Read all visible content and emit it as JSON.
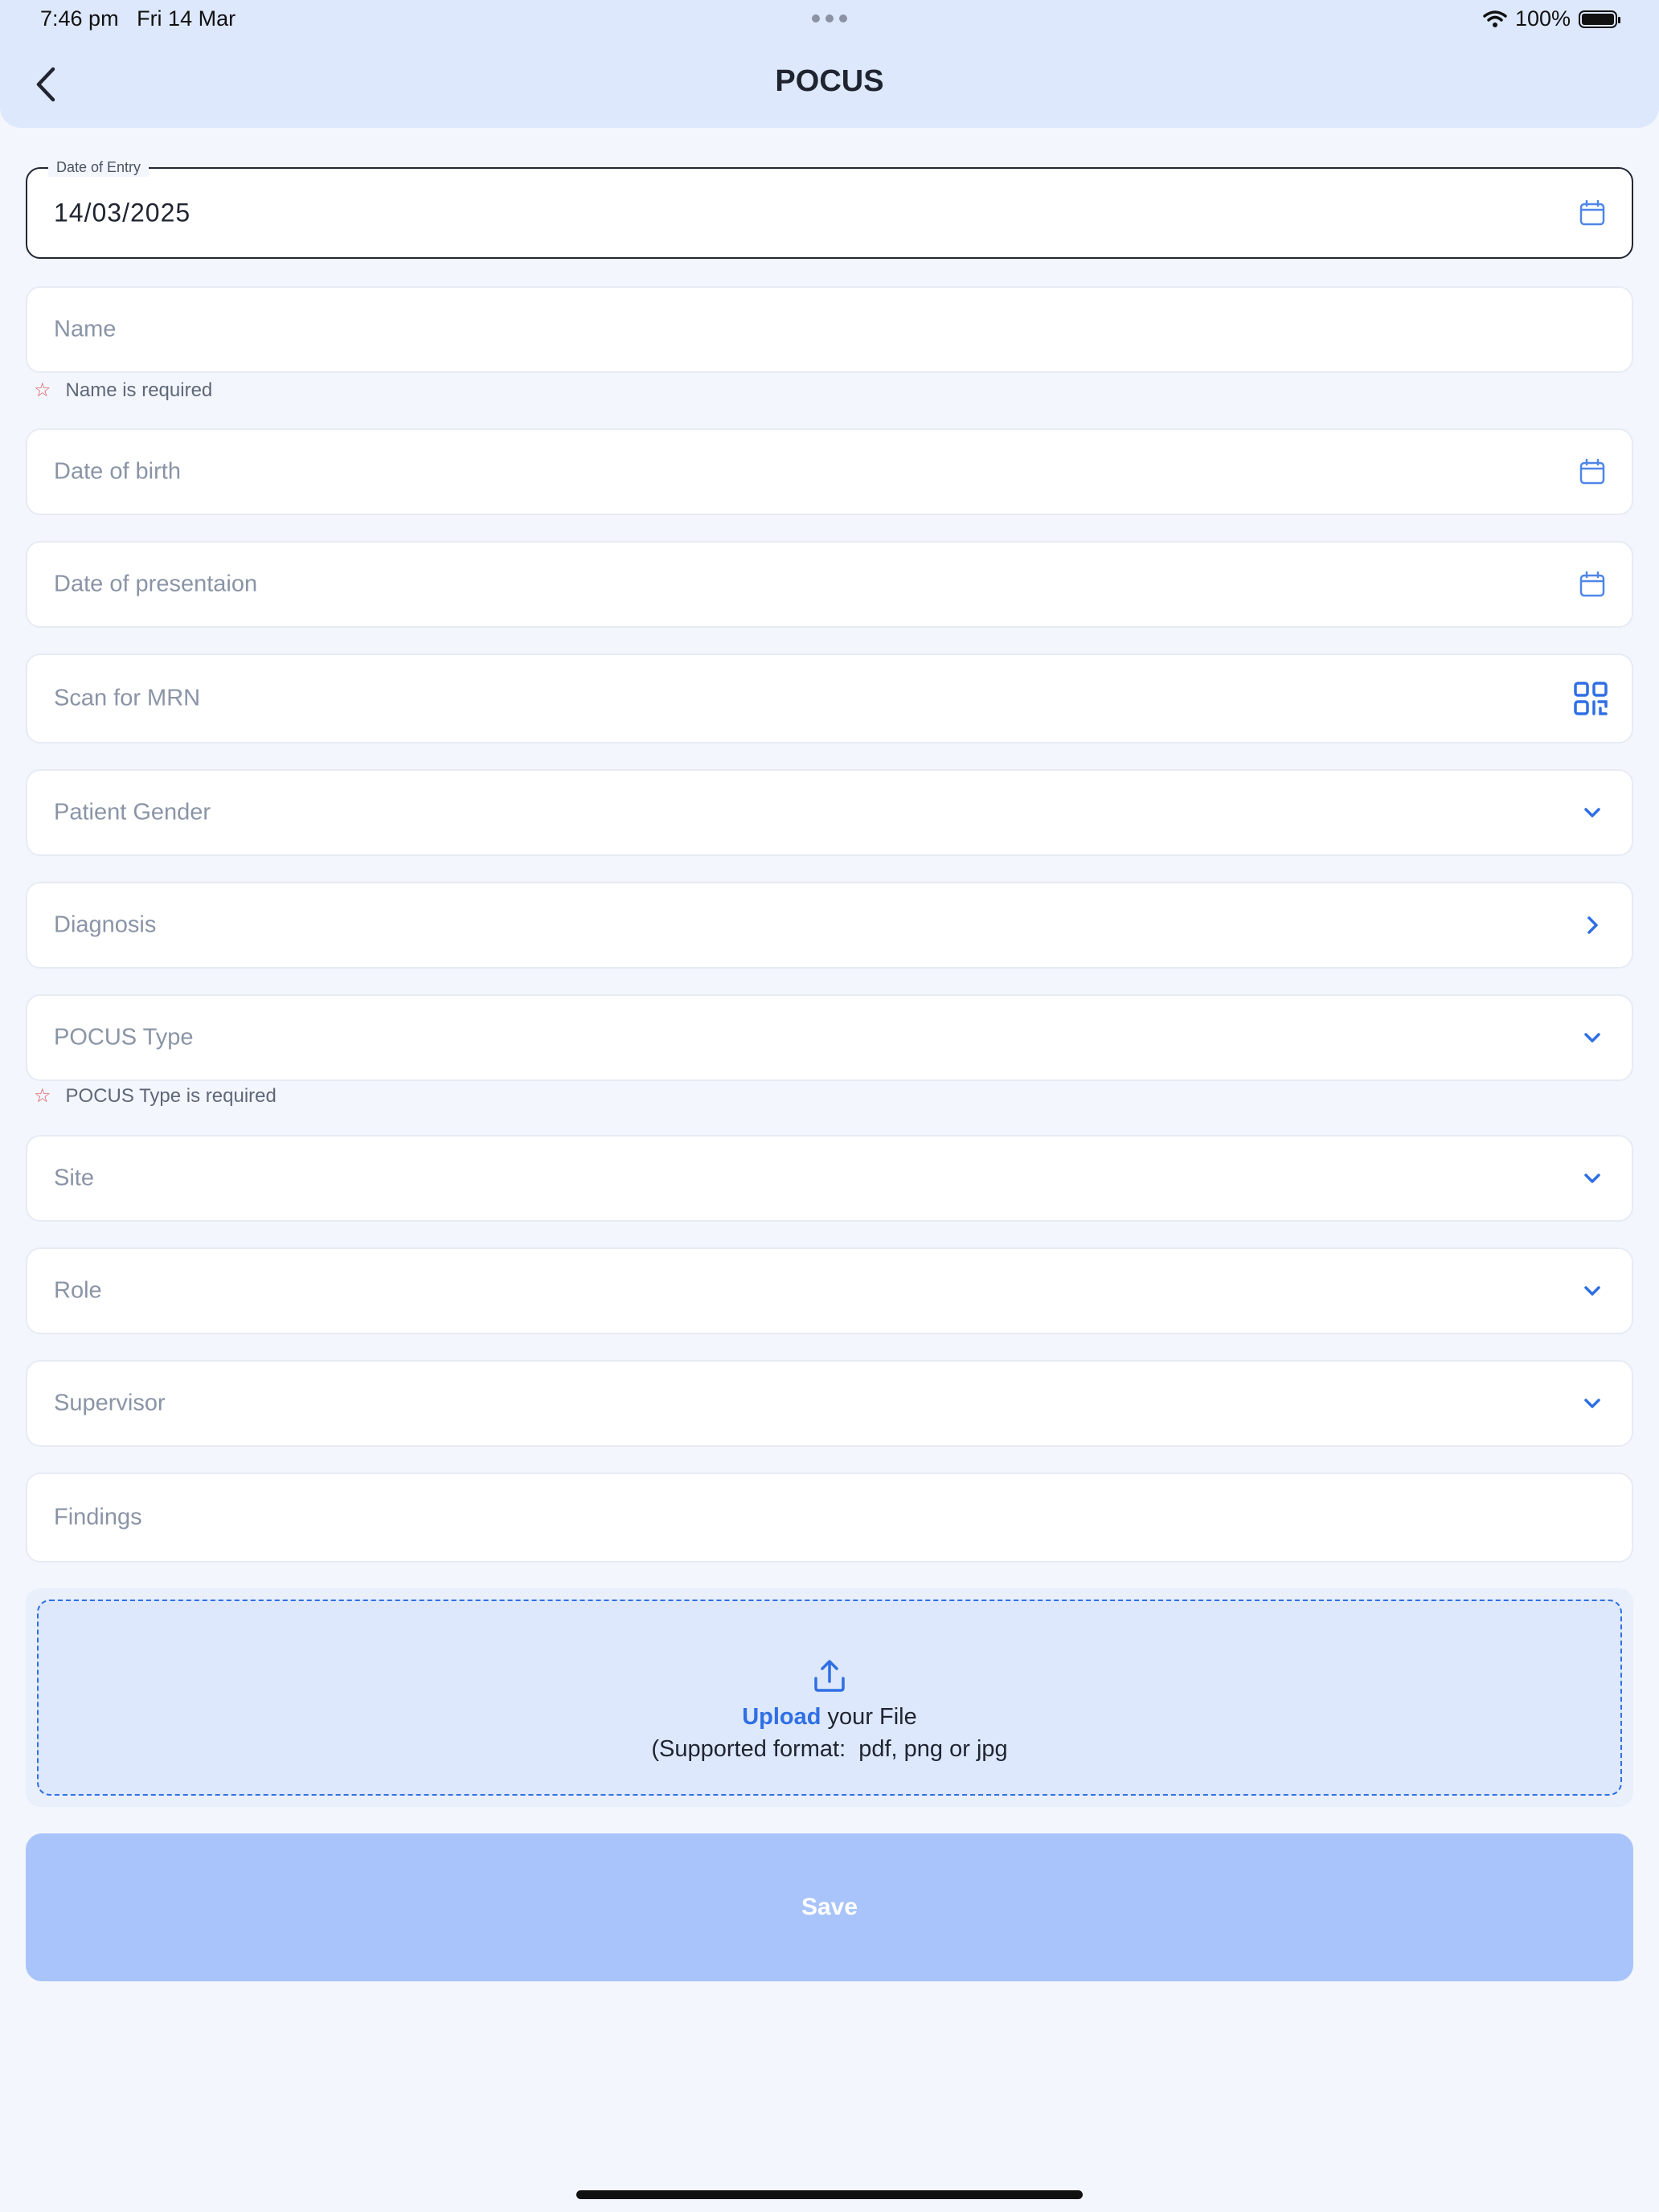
{
  "status_bar": {
    "time": "7:46 pm",
    "date": "Fri 14 Mar",
    "battery": "100%"
  },
  "header": {
    "title": "POCUS"
  },
  "form": {
    "date_of_entry": {
      "label": "Date of Entry",
      "value": "14/03/2025"
    },
    "name": {
      "placeholder": "Name",
      "error": "Name is required"
    },
    "date_of_birth": {
      "placeholder": "Date of birth"
    },
    "date_of_presentation": {
      "placeholder": "Date of presentaion"
    },
    "mrn": {
      "placeholder": "Scan for MRN"
    },
    "gender": {
      "placeholder": "Patient Gender"
    },
    "diagnosis": {
      "placeholder": "Diagnosis"
    },
    "pocus_type": {
      "placeholder": "POCUS Type",
      "error": "POCUS Type is required"
    },
    "site": {
      "placeholder": "Site"
    },
    "role": {
      "placeholder": "Role"
    },
    "supervisor": {
      "placeholder": "Supervisor"
    },
    "findings": {
      "placeholder": "Findings"
    }
  },
  "upload": {
    "link_text": "Upload",
    "text": " your File",
    "formats": "(Supported format:  pdf, png or jpg"
  },
  "save_label": "Save",
  "colors": {
    "accent": "#2f6fe4",
    "header_bg": "#dde8fc",
    "save_bg": "#a9c4fb",
    "error_star": "#e0535a"
  }
}
